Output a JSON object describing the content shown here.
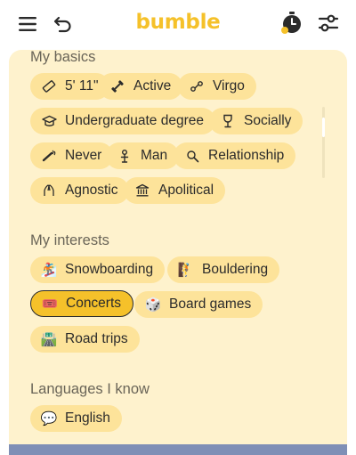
{
  "header": {
    "logo": "bumble",
    "icons": {
      "menu": "hamburger-menu-icon",
      "back": "undo-arrow-icon",
      "timer": "stopwatch-icon",
      "filter": "filter-sliders-icon"
    }
  },
  "colors": {
    "brand": "#f5c12a",
    "card": "#fef2cd",
    "chip": "#fde39a"
  },
  "basics": {
    "title": "My basics",
    "items": [
      {
        "label": "5' 11\"",
        "icon": "ruler-icon"
      },
      {
        "label": "Active",
        "icon": "dumbbell-icon"
      },
      {
        "label": "Virgo",
        "icon": "zodiac-icon"
      },
      {
        "label": "Undergraduate degree",
        "icon": "graduation-cap-icon"
      },
      {
        "label": "Socially",
        "icon": "wine-glass-icon"
      },
      {
        "label": "Never",
        "icon": "smoking-icon"
      },
      {
        "label": "Man",
        "icon": "gender-icon"
      },
      {
        "label": "Relationship",
        "icon": "search-icon"
      },
      {
        "label": "Agnostic",
        "icon": "praying-hands-icon"
      },
      {
        "label": "Apolitical",
        "icon": "government-building-icon"
      }
    ]
  },
  "interests": {
    "title": "My interests",
    "items": [
      {
        "label": "Snowboarding",
        "emoji": "🏂",
        "selected": false
      },
      {
        "label": "Bouldering",
        "emoji": "🧗",
        "selected": false
      },
      {
        "label": "Concerts",
        "emoji": "🎟️",
        "selected": true
      },
      {
        "label": "Board games",
        "emoji": "🎲",
        "selected": false
      },
      {
        "label": "Road trips",
        "emoji": "🛣️",
        "selected": false
      }
    ]
  },
  "languages": {
    "title": "Languages I know",
    "items": [
      {
        "label": "English",
        "emoji": "💬"
      }
    ]
  }
}
